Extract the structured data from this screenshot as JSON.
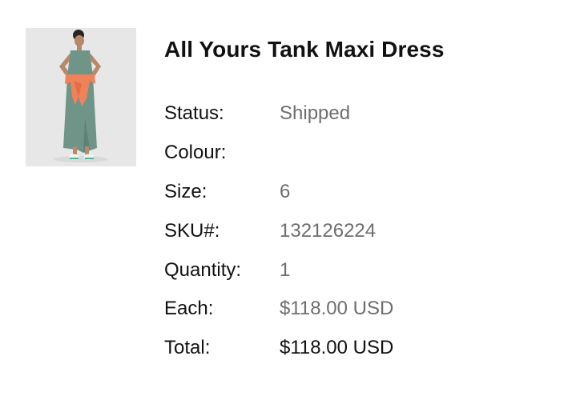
{
  "product": {
    "title": "All Yours Tank Maxi Dress",
    "image_alt": "product-photo",
    "colors": {
      "text_primary": "#111111",
      "text_secondary": "#6e6e6e",
      "dress": "#6f9488",
      "sweatshirt": "#f0825a",
      "photo_bg": "#e7e7e8"
    }
  },
  "details": {
    "status_label": "Status:",
    "status_value": "Shipped",
    "colour_label": "Colour:",
    "colour_value": "",
    "size_label": "Size:",
    "size_value": "6",
    "sku_label": "SKU#:",
    "sku_value": "132126224",
    "quantity_label": "Quantity:",
    "quantity_value": "1",
    "each_label": "Each:",
    "each_value": "$118.00 USD",
    "total_label": "Total:",
    "total_value": "$118.00 USD"
  }
}
